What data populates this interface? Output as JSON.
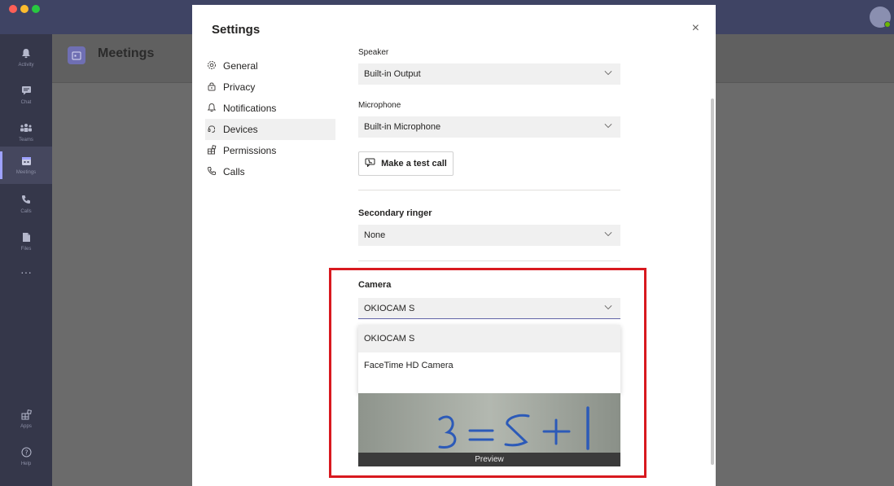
{
  "rail": {
    "items": [
      {
        "label": "Activity",
        "icon": "bell-icon"
      },
      {
        "label": "Chat",
        "icon": "chat-icon"
      },
      {
        "label": "Teams",
        "icon": "teams-icon"
      },
      {
        "label": "Meetings",
        "icon": "calendar-icon"
      },
      {
        "label": "Calls",
        "icon": "phone-icon"
      },
      {
        "label": "Files",
        "icon": "file-icon"
      },
      {
        "label": "Apps",
        "icon": "apps-icon"
      },
      {
        "label": "Help",
        "icon": "help-icon"
      }
    ],
    "more": "···"
  },
  "header": {
    "title": "Meetings"
  },
  "settings": {
    "title": "Settings",
    "close": "×",
    "nav": [
      {
        "label": "General",
        "icon": "gear-icon"
      },
      {
        "label": "Privacy",
        "icon": "lock-icon"
      },
      {
        "label": "Notifications",
        "icon": "bell-icon"
      },
      {
        "label": "Devices",
        "icon": "headset-icon"
      },
      {
        "label": "Permissions",
        "icon": "permissions-icon"
      },
      {
        "label": "Calls",
        "icon": "phone-icon"
      }
    ],
    "speaker": {
      "label": "Speaker",
      "value": "Built-in Output"
    },
    "microphone": {
      "label": "Microphone",
      "value": "Built-in Microphone"
    },
    "test_call": "Make a test call",
    "secondary_ringer": {
      "label": "Secondary ringer",
      "value": "None"
    },
    "camera": {
      "label": "Camera",
      "value": "OKIOCAM S",
      "options": [
        "OKIOCAM S",
        "FaceTime HD Camera"
      ],
      "preview_label": "Preview"
    }
  },
  "colors": {
    "accent": "#6264a7",
    "highlight": "#d8191f",
    "rail": "#35374a",
    "titlebar": "#3f4464"
  }
}
